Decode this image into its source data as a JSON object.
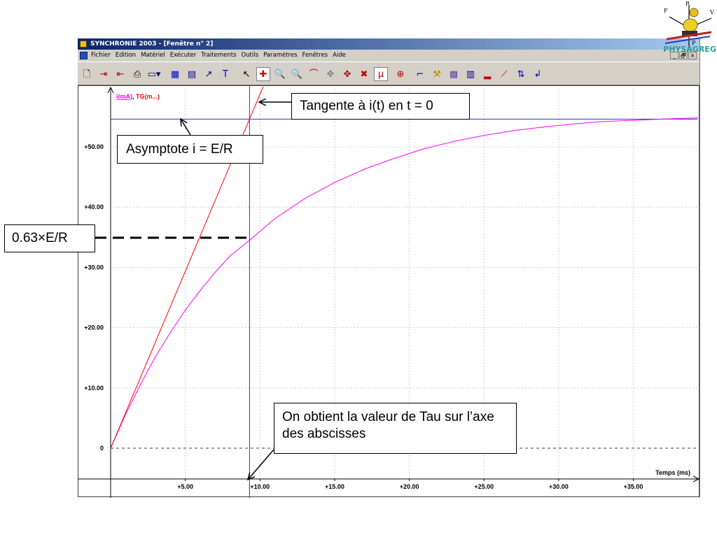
{
  "window": {
    "title": "SYNCHRONIE 2003 - [Fenêtre n° 2]",
    "controls": [
      "_",
      "🗗",
      "×"
    ]
  },
  "menu": {
    "items": [
      "Fichier",
      "Edition",
      "Matériel",
      "Exécuter",
      "Traitements",
      "Outils",
      "Paramètres",
      "Fenêtres",
      "Aide"
    ]
  },
  "toolbar": {
    "buttons": [
      {
        "name": "new-file-icon",
        "glyph": "🗋",
        "color": "#000000"
      },
      {
        "name": "import-icon",
        "glyph": "⇥",
        "color": "#c00000"
      },
      {
        "name": "export-icon",
        "glyph": "⇤",
        "color": "#c00000"
      },
      {
        "name": "print-icon",
        "glyph": "⎙",
        "color": "#000000"
      },
      {
        "name": "display-dropdown-icon",
        "glyph": "▭▾",
        "color": "#000080"
      },
      {
        "name": "table-icon",
        "glyph": "▦",
        "color": "#0000c0"
      },
      {
        "name": "list-icon",
        "glyph": "▤",
        "color": "#000080"
      },
      {
        "name": "pen-icon",
        "glyph": "↗",
        "color": "#000080"
      },
      {
        "name": "text-tool-icon",
        "glyph": "T",
        "color": "#0000c0"
      },
      {
        "name": "pointer-icon",
        "glyph": "↖",
        "color": "#000000"
      },
      {
        "name": "cursor-cross-icon",
        "glyph": "✚",
        "color": "#d00000",
        "active": true
      },
      {
        "name": "zoom-in-icon",
        "glyph": "🔍",
        "color": "#c00000"
      },
      {
        "name": "zoom-out-icon",
        "glyph": "🔍",
        "color": "#404040"
      },
      {
        "name": "curve-icon",
        "glyph": "⌒",
        "color": "#c00000"
      },
      {
        "name": "move-icon",
        "glyph": "✥",
        "color": "#808080"
      },
      {
        "name": "pan-icon",
        "glyph": "✥",
        "color": "#c00000"
      },
      {
        "name": "delete-points-icon",
        "glyph": "✖",
        "color": "#c00000"
      },
      {
        "name": "mu-icon",
        "glyph": "μ",
        "color": "#c00000",
        "active": true
      },
      {
        "name": "target-icon",
        "glyph": "⊕",
        "color": "#c00000"
      },
      {
        "name": "step-icon",
        "glyph": "⌐",
        "color": "#0000c0"
      },
      {
        "name": "hammer-icon",
        "glyph": "⚒",
        "color": "#c08000"
      },
      {
        "name": "grid-3d-icon",
        "glyph": "▩",
        "color": "#6040a0"
      },
      {
        "name": "model-icon",
        "glyph": "▥",
        "color": "#000080"
      },
      {
        "name": "histogram-icon",
        "glyph": "▂",
        "color": "#c00000"
      },
      {
        "name": "regression-icon",
        "glyph": "⟋",
        "color": "#c00000"
      },
      {
        "name": "swap-axes-icon",
        "glyph": "⇅",
        "color": "#0000c0"
      },
      {
        "name": "undo-icon",
        "glyph": "↲",
        "color": "#0000c0"
      }
    ]
  },
  "chart_data": {
    "type": "line",
    "title": "",
    "xlabel": "Temps (ms)",
    "ylabel": "i(mA), TG(m...)",
    "ylabel_parts": [
      "i(mA)",
      ", ",
      "TG(m...)"
    ],
    "xlim": [
      0,
      39.3
    ],
    "ylim": [
      -6,
      58.5
    ],
    "x_ticks": [
      5,
      10,
      15,
      20,
      25,
      30,
      35
    ],
    "x_tick_labels": [
      "+5.00",
      "+10.00",
      "+15.00",
      "+20.00",
      "+25.00",
      "+30.00",
      "+35.00"
    ],
    "y_ticks": [
      0,
      10,
      20,
      30,
      40,
      50
    ],
    "y_tick_labels": [
      "0",
      "+10.00",
      "+20.00",
      "+30.00",
      "+40.00",
      "+50.00"
    ],
    "grid": true,
    "asymptote_value": 54.6,
    "tau_ms": 9.3,
    "series": [
      {
        "name": "i(mA)",
        "color": "#ff00ff",
        "x": [
          0,
          1,
          2,
          3,
          4,
          5,
          6,
          7,
          8,
          9.3,
          11,
          13,
          15,
          17,
          19,
          21,
          23,
          25,
          27,
          29,
          31,
          33,
          35,
          37,
          39.3
        ],
        "y": [
          0,
          5.6,
          10.6,
          15.2,
          19.2,
          22.9,
          26.2,
          29.2,
          31.9,
          34.5,
          38.1,
          41.4,
          44.1,
          46.3,
          48.1,
          49.7,
          50.9,
          51.9,
          52.7,
          53.3,
          53.8,
          54.2,
          54.4,
          54.6,
          54.8
        ]
      },
      {
        "name": "TG(m...)",
        "color": "#ff0000",
        "x": [
          0,
          10.2
        ],
        "y": [
          0,
          59.9
        ]
      }
    ],
    "asymptote_color": "#3030c0",
    "tau_line_color": "#3030c0"
  },
  "annotations": {
    "tangent": "Tangente à i(t) en t = 0",
    "asymptote": "Asymptote i = E/R",
    "level": "0.63×E/R",
    "tau_note": "On obtient la valeur de Tau sur l’axe des abscisses"
  },
  "logo": {
    "text": "PHYSAGREG",
    "vector_labels": [
      "F",
      "R",
      "V",
      "P"
    ]
  }
}
